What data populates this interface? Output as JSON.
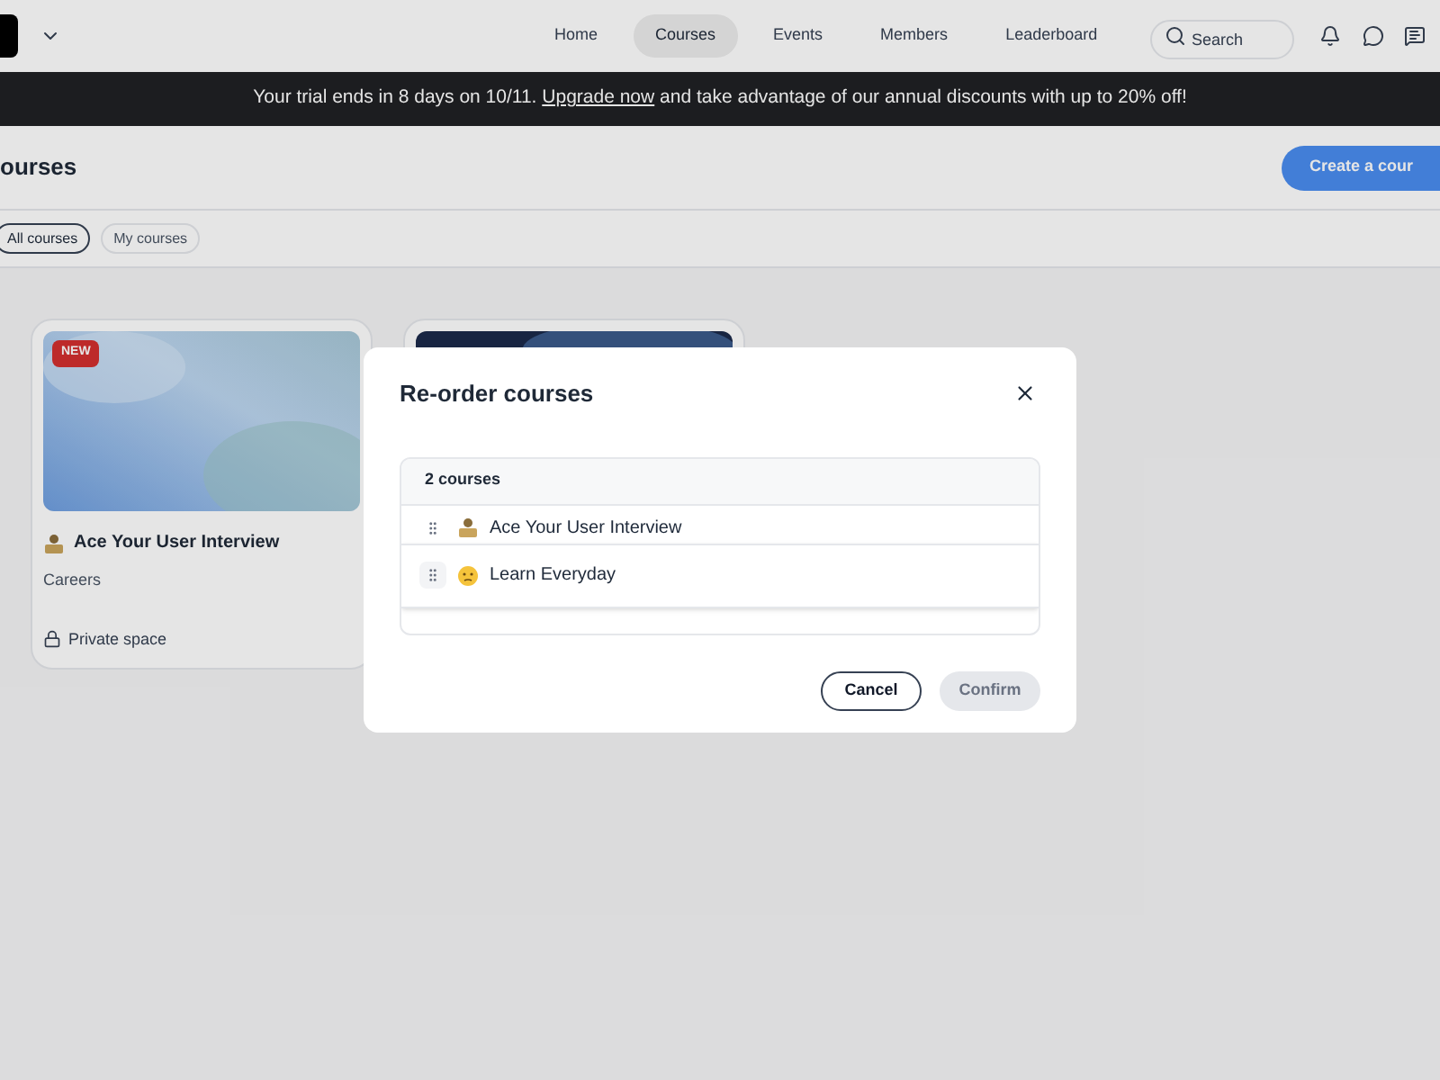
{
  "nav": {
    "items": [
      {
        "label": "Home",
        "selected": false
      },
      {
        "label": "Courses",
        "selected": true
      },
      {
        "label": "Events",
        "selected": false
      },
      {
        "label": "Members",
        "selected": false
      },
      {
        "label": "Leaderboard",
        "selected": false
      }
    ],
    "search": {
      "placeholder": "Search"
    }
  },
  "banner": {
    "before": "Your trial ends in 8 days on 10/11.",
    "link": "Upgrade now",
    "after": "and take advantage of our annual discounts with up to 20% off!"
  },
  "page": {
    "title": "ourses",
    "create_button": "Create a cour",
    "filters": [
      {
        "label": "All courses",
        "selected": true
      },
      {
        "label": "My courses",
        "selected": false
      }
    ]
  },
  "cards": [
    {
      "badge": "NEW",
      "title": "Ace Your User Interview",
      "category": "Careers",
      "visibility": "Private space"
    }
  ],
  "dialog": {
    "title": "Re-order courses",
    "count": "2 courses",
    "courses": [
      {
        "name": "Ace Your User Interview",
        "dragging": false
      },
      {
        "name": "Learn Everyday",
        "dragging": true
      }
    ],
    "buttons": [
      {
        "label": "Cancel",
        "disabled": false
      },
      {
        "label": "Confirm",
        "disabled": true
      }
    ]
  }
}
